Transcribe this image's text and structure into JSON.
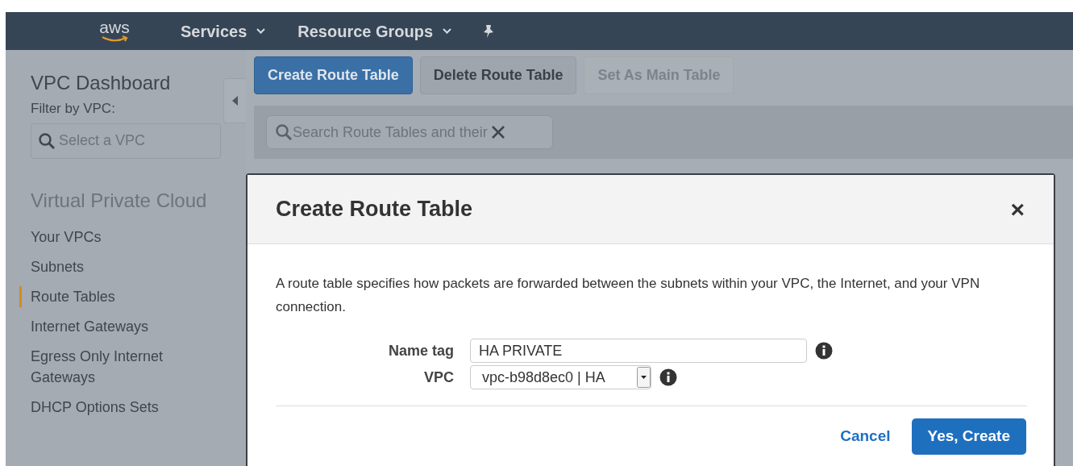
{
  "navbar": {
    "logo": "aws",
    "menus": [
      {
        "label": "Services"
      },
      {
        "label": "Resource Groups"
      }
    ]
  },
  "sidebar": {
    "title": "VPC Dashboard",
    "filter_label": "Filter by VPC:",
    "filter_placeholder": "Select a VPC",
    "section": "Virtual Private Cloud",
    "items": [
      {
        "label": "Your VPCs",
        "selected": false
      },
      {
        "label": "Subnets",
        "selected": false
      },
      {
        "label": "Route Tables",
        "selected": true
      },
      {
        "label": "Internet Gateways",
        "selected": false
      },
      {
        "label": "Egress Only Internet Gateways",
        "selected": false
      },
      {
        "label": "DHCP Options Sets",
        "selected": false
      }
    ]
  },
  "toolbar": [
    {
      "label": "Create Route Table",
      "kind": "primary",
      "disabled": false
    },
    {
      "label": "Delete Route Table",
      "kind": "default",
      "disabled": false
    },
    {
      "label": "Set As Main Table",
      "kind": "default",
      "disabled": true
    }
  ],
  "search": {
    "placeholder": "Search Route Tables and their"
  },
  "dialog": {
    "title": "Create Route Table",
    "close": "×",
    "description": "A route table specifies how packets are forwarded between the subnets within your VPC, the Internet, and your VPN connection.",
    "fields": [
      {
        "label": "Name tag",
        "kind": "text",
        "value": "HA PRIVATE"
      },
      {
        "label": "VPC",
        "kind": "select",
        "value": "vpc-b98d8ec0 | HA"
      }
    ],
    "buttons": [
      {
        "label": "Cancel",
        "kind": "link"
      },
      {
        "label": "Yes, Create",
        "kind": "primary"
      }
    ]
  }
}
